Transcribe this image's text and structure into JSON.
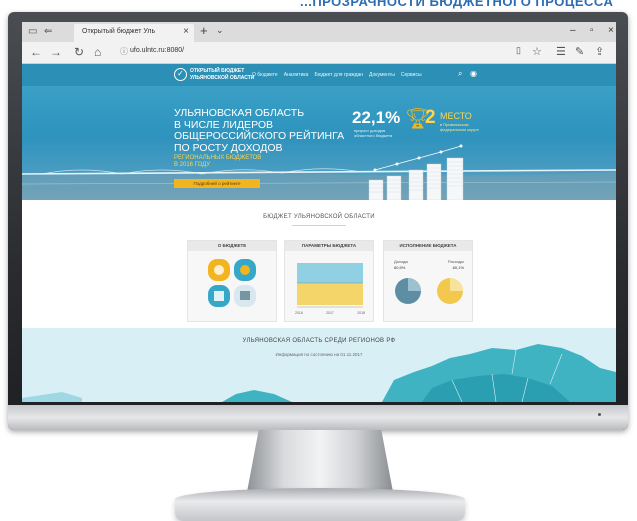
{
  "slide_header": "...ПРОЗРАЧНОСТИ БЮДЖЕТНОГО ПРОЦЕССА",
  "browser": {
    "tab_title": "Открытый бюджет Уль",
    "url": "ufo.ulntc.ru:8080/"
  },
  "site": {
    "logo_line1": "ОТКРЫТЫЙ БЮДЖЕТ",
    "logo_line2": "УЛЬЯНОВСКОЙ ОБЛАСТИ",
    "nav": [
      "О бюджете",
      "Аналитика",
      "Бюджет для граждан",
      "Документы",
      "Сервисы"
    ]
  },
  "hero": {
    "title_lines": [
      "УЛЬЯНОВСКАЯ ОБЛАСТЬ",
      "В ЧИСЛЕ ЛИДЕРОВ",
      "ОБЩЕРОССИЙСКОГО РЕЙТИНГА",
      "ПО РОСТУ ДОХОДОВ"
    ],
    "subtitle_lines": [
      "РЕГИОНАЛЬНЫХ БЮДЖЕТОВ",
      "В 2016 ГОДУ"
    ],
    "button_label": "Подробней о рейтинге",
    "stat_value": "22,1%",
    "stat_caption": [
      "прирост доходов",
      "областного бюджета"
    ],
    "place_number": "2",
    "place_word": "МЕСТО",
    "place_caption": [
      "в Приволжском",
      "федеральном округе"
    ]
  },
  "budget": {
    "section_title": "БЮДЖЕТ УЛЬЯНОВСКОЙ ОБЛАСТИ",
    "cards": [
      {
        "title": "О БЮДЖЕТЕ"
      },
      {
        "title": "ПАРАМЕТРЫ БЮДЖЕТА",
        "years": [
          "2016",
          "2017",
          "2018"
        ]
      },
      {
        "title": "ИСПОЛНЕНИЕ БЮДЖЕТА",
        "income_label": "Доходы",
        "expense_label": "Расходы",
        "income_pct": "80,5%",
        "expense_pct": "80,1%"
      }
    ]
  },
  "regions": {
    "title": "УЛЬЯНОВСКАЯ ОБЛАСТЬ СРЕДИ РЕГИОНОВ РФ",
    "subtitle": "Информация по состоянию на 01.11.2017"
  },
  "colors": {
    "site_header": "#2c8fb5",
    "accent_gold": "#f2b51f",
    "teal": "#35a7c9"
  }
}
